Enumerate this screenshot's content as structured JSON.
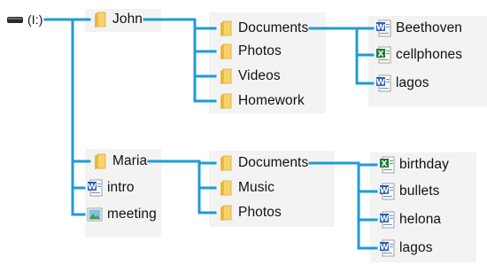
{
  "colors": {
    "connector": "#1e9bd7",
    "folder": "#f2c24b",
    "panel": "#f3f3f3"
  },
  "root": {
    "label": "(I:)",
    "icon": "drive-icon"
  },
  "tree": [
    {
      "id": "john",
      "label": "John",
      "icon": "folder-icon",
      "children": [
        {
          "id": "john-documents",
          "label": "Documents",
          "icon": "folder-icon",
          "children": [
            {
              "id": "john-doc-beethoven",
              "label": "Beethoven",
              "icon": "word-document-icon"
            },
            {
              "id": "john-doc-cellphones",
              "label": "cellphones",
              "icon": "excel-spreadsheet-icon"
            },
            {
              "id": "john-doc-lagos",
              "label": "lagos",
              "icon": "word-document-icon"
            }
          ]
        },
        {
          "id": "john-photos",
          "label": "Photos",
          "icon": "folder-icon"
        },
        {
          "id": "john-videos",
          "label": "Videos",
          "icon": "folder-icon"
        },
        {
          "id": "john-homework",
          "label": "Homework",
          "icon": "folder-icon"
        }
      ]
    },
    {
      "id": "maria",
      "label": "Maria",
      "icon": "folder-icon",
      "children": [
        {
          "id": "maria-documents",
          "label": "Documents",
          "icon": "folder-icon",
          "children": [
            {
              "id": "maria-doc-birthday",
              "label": "birthday",
              "icon": "excel-spreadsheet-icon"
            },
            {
              "id": "maria-doc-bullets",
              "label": "bullets",
              "icon": "word-document-icon"
            },
            {
              "id": "maria-doc-helona",
              "label": "helona",
              "icon": "word-document-icon"
            },
            {
              "id": "maria-doc-lagos",
              "label": "lagos",
              "icon": "word-document-icon"
            }
          ]
        },
        {
          "id": "maria-music",
          "label": "Music",
          "icon": "folder-icon"
        },
        {
          "id": "maria-photos",
          "label": "Photos",
          "icon": "folder-icon"
        }
      ]
    },
    {
      "id": "intro",
      "label": "intro",
      "icon": "word-document-icon"
    },
    {
      "id": "meeting",
      "label": "meeting",
      "icon": "image-file-icon"
    }
  ]
}
